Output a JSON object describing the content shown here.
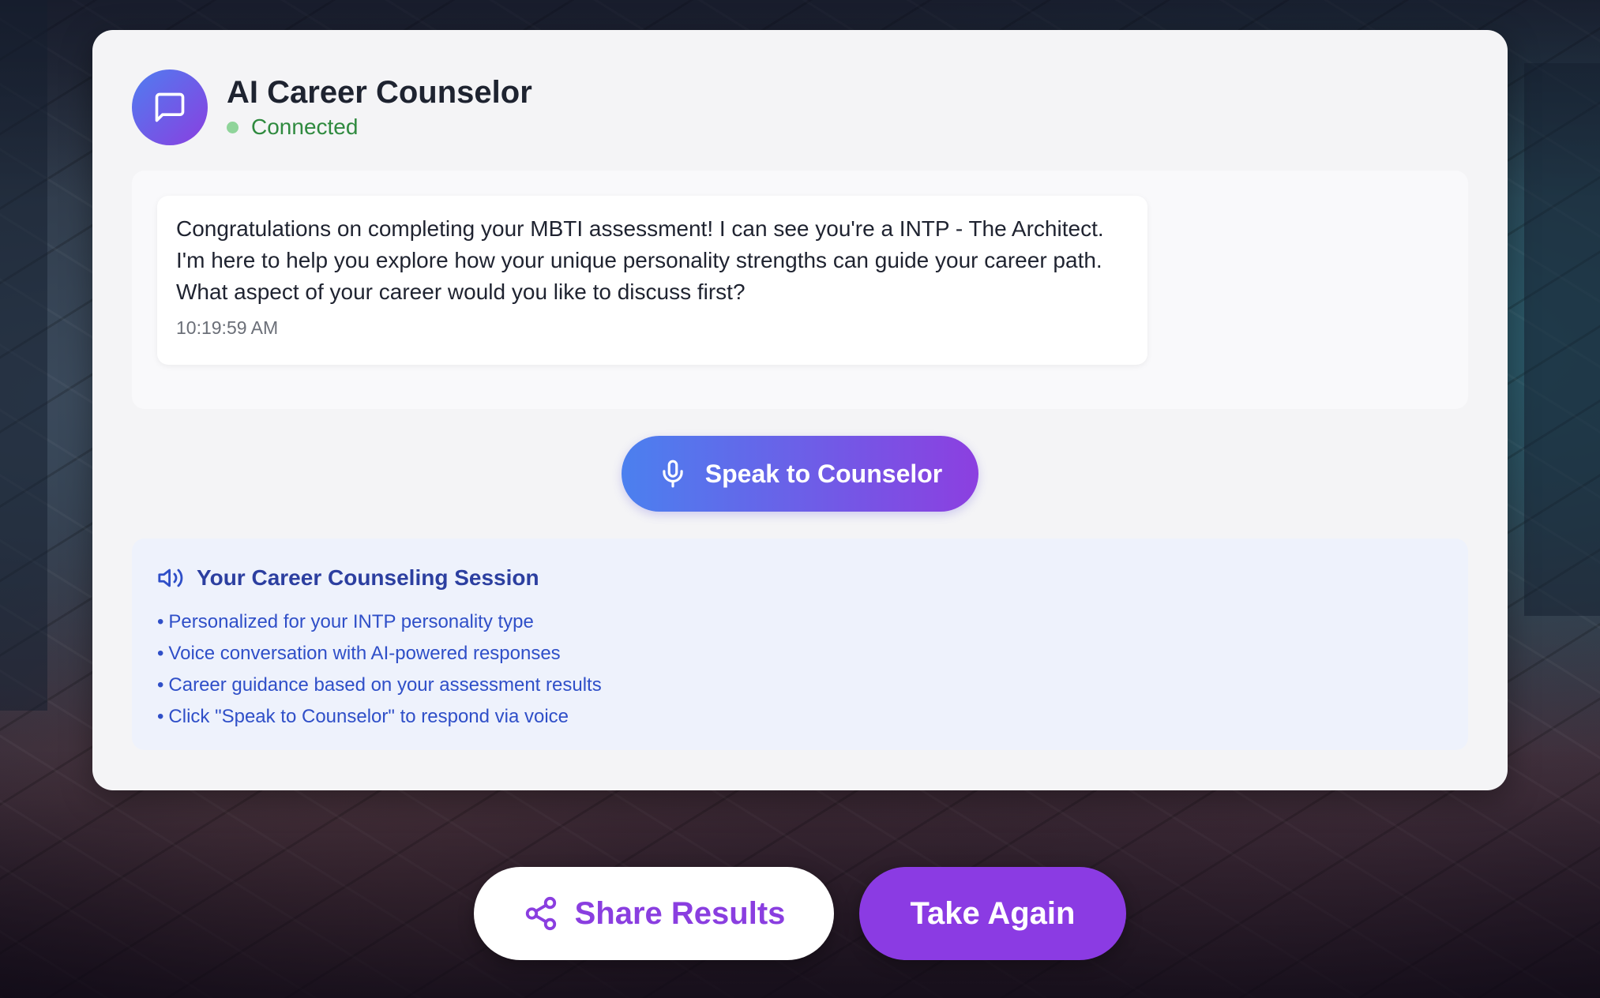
{
  "counselor": {
    "title": "AI Career Counselor",
    "status": "Connected",
    "avatar_icon": "chat-bubble-icon"
  },
  "chat": {
    "messages": [
      {
        "text": "Congratulations on completing your MBTI assessment! I can see you're a INTP - The Architect. I'm here to help you explore how your unique personality strengths can guide your career path. What aspect of your career would you like to discuss first?",
        "time": "10:19:59 AM"
      }
    ]
  },
  "speak_button": {
    "label": "Speak to Counselor",
    "icon": "microphone-icon"
  },
  "session_info": {
    "title": "Your Career Counseling Session",
    "icon": "speaker-icon",
    "items": [
      "Personalized for your INTP personality type",
      "Voice conversation with AI-powered responses",
      "Career guidance based on your assessment results",
      "Click \"Speak to Counselor\" to respond via voice"
    ],
    "bullet": "•"
  },
  "actions": {
    "share_label": "Share Results",
    "share_icon": "share-icon",
    "again_label": "Take Again"
  },
  "colors": {
    "accent_purple": "#8b3be3",
    "accent_blue": "#4b80ef",
    "status_green": "#2f8a3f",
    "info_text": "#2f4fc8"
  }
}
